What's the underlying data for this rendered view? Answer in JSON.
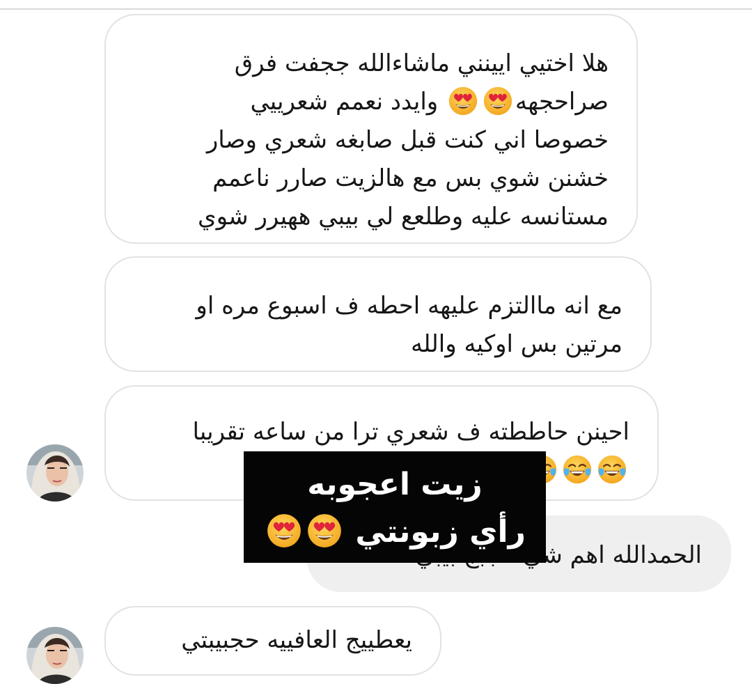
{
  "chat": {
    "messages": [
      {
        "lines": [
          "هلا اختيي ايينني ماشاءالله ججفت فرق",
          "وايدد نعمم شعرييي",
          "خصوصا اني كنت قبل صابغه شعري وصار",
          "خشنن شوي بس مع هالزيت صارر ناعمم",
          "مستانسه عليه  وطلعع لي بيبي ههيرر شوي"
        ],
        "line2_tail": "صراحجهه"
      },
      {
        "lines": [
          "مع انه ماالتزم عليهه احطه ف اسبوع مره او",
          "مرتين بس اوكيه والله"
        ]
      },
      {
        "lines": [
          "احينن حاططته ف شعري ترا من ساعه تقريبا"
        ]
      },
      {
        "lines": [
          "الحمدالله اهم شي عجبج بيبي"
        ]
      },
      {
        "lines": [
          "يعطييج العافييه حجبيبتي"
        ]
      }
    ]
  },
  "overlay": {
    "line1": "زيت اعجوبه",
    "line2": "رأي زبونتي"
  },
  "icons": {
    "heart_eyes": "smiling-face-with-heart-eyes-emoji",
    "joy": "face-with-tears-of-joy-emoji",
    "heart": "red-heart-emoji",
    "avatar": "user-avatar"
  },
  "colors": {
    "received_bubble_border": "#e2e2e2",
    "sent_bubble_fill": "#efefef",
    "overlay_bg": "#050505",
    "text": "#161616",
    "emoji_yellow": "#f7b52c",
    "heart_red": "#d5192a"
  }
}
